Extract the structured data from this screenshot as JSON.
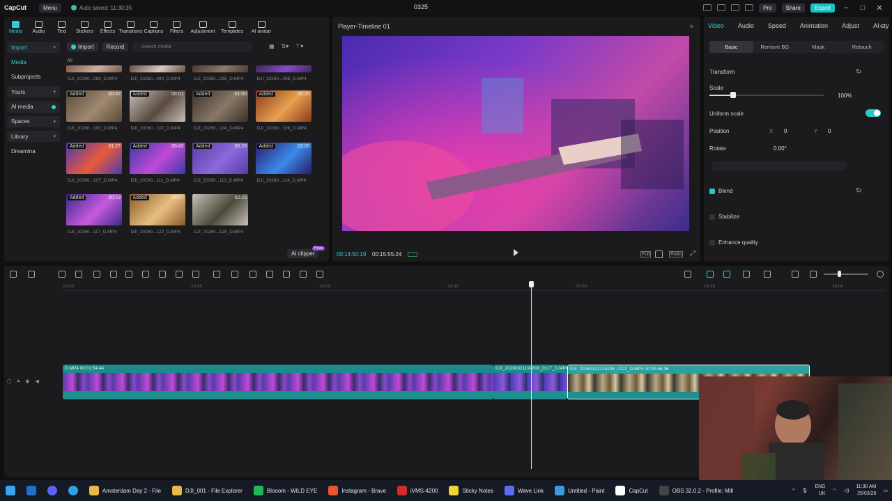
{
  "titlebar": {
    "logo": "CapCut",
    "menu": "Menu",
    "autosave": "Auto saved: 11:30:35",
    "project": "0325",
    "pro": "Pro",
    "share": "Share",
    "export": "Export"
  },
  "media_tabs": [
    "Media",
    "Audio",
    "Text",
    "Stickers",
    "Effects",
    "Transitions",
    "Captions",
    "Filters",
    "Adjustment",
    "Templates",
    "AI avatar"
  ],
  "side_nav": [
    "Import",
    "Media",
    "Subprojects",
    "Yours",
    "AI media",
    "Spaces",
    "Library",
    "Dreamina"
  ],
  "media_actions": {
    "import": "Import",
    "record": "Record",
    "search_placeholder": "Search media",
    "all": "All"
  },
  "media_items": [
    {
      "name": "DJI_20260...089_D.MP4",
      "added": "",
      "dur": ""
    },
    {
      "name": "DJI_20260...090_D.MP4",
      "added": "",
      "dur": ""
    },
    {
      "name": "DJI_20260...095_D.MP4",
      "added": "",
      "dur": ""
    },
    {
      "name": "DJI_20260...098_D.MP4",
      "added": "",
      "dur": ""
    },
    {
      "name": "DJI_20260...100_D.MP4",
      "added": "Added",
      "dur": "00:42"
    },
    {
      "name": "DJI_20260...102_D.MP4",
      "added": "Added",
      "dur": "00:01"
    },
    {
      "name": "DJI_20260...104_D.MP4",
      "added": "Added",
      "dur": "01:00"
    },
    {
      "name": "DJI_20260...106_D.MP4",
      "added": "Added",
      "dur": "00:25"
    },
    {
      "name": "DJI_20260...107_D.MP4",
      "added": "Added",
      "dur": "01:27"
    },
    {
      "name": "DJI_20260...111_D.MP4",
      "added": "Added",
      "dur": "00:43"
    },
    {
      "name": "DJI_20260...112_D.MP4",
      "added": "Added",
      "dur": "00:29"
    },
    {
      "name": "DJI_20260...114_D.MP4",
      "added": "Added",
      "dur": "02:00"
    },
    {
      "name": "DJI_20260...117_D.MP4",
      "added": "Added",
      "dur": "00:19"
    },
    {
      "name": "DJI_20260...122_D.MP4",
      "added": "Added",
      "dur": "00:57"
    },
    {
      "name": "DJI_20260...125_D.MP4",
      "added": "",
      "dur": "02:23"
    }
  ],
  "ai_clipper": "AI clipper",
  "free": "Free",
  "player": {
    "title": "Player-Timeline 01",
    "current": "00:14:50:19",
    "total": "00:15:55:24",
    "ratio": "Ratio"
  },
  "props": {
    "tabs": [
      "Video",
      "Audio",
      "Speed",
      "Animation",
      "Adjust",
      "AI sty"
    ],
    "subtabs": [
      "Basic",
      "Remove BG",
      "Mask",
      "Retouch"
    ],
    "transform": "Transform",
    "scale": "Scale",
    "scale_value": "100%",
    "uniform_scale": "Uniform scale",
    "position": "Position",
    "x_label": "X",
    "x_value": "0",
    "y_label": "Y",
    "y_value": "0",
    "rotate": "Rotate",
    "rotate_value": "0.00°",
    "blend": "Blend",
    "stabilize": "Stabilize",
    "enhance": "Enhance quality"
  },
  "ruler_ticks": [
    "13:00",
    "13:30",
    "14:00",
    "14:30",
    "15:00",
    "15:30",
    "16:00"
  ],
  "clips": [
    {
      "label": "D.MP4   00:01:54:44"
    },
    {
      "label": "DJI_20260321194808_0117_D.MP4"
    },
    {
      "label": "DJI_20260321215238_0122_D.MP4   00:00:56:36"
    }
  ],
  "taskbar": [
    {
      "label": "Amsterdam Day 2 - File",
      "color": "#e8b84a"
    },
    {
      "label": "DJI_001 - File Explorer",
      "color": "#e8b84a"
    },
    {
      "label": "Blooom - WILD EYE",
      "color": "#1db954"
    },
    {
      "label": "Instagram - Brave",
      "color": "#e8562a"
    },
    {
      "label": "iVMS-4200",
      "color": "#d42a2a"
    },
    {
      "label": "Sticky Notes",
      "color": "#f2d23a"
    },
    {
      "label": "Wave Link",
      "color": "#5b6cf0"
    },
    {
      "label": "Untitled - Paint",
      "color": "#3b9ad9"
    },
    {
      "label": "CapCut",
      "color": "#ffffff"
    },
    {
      "label": "OBS 32.0.2 - Profile: Mill",
      "color": "#444444"
    }
  ],
  "tray": {
    "lang1": "ENG",
    "lang2": "UK",
    "time": "11:30 AM",
    "date": "25/03/26"
  }
}
